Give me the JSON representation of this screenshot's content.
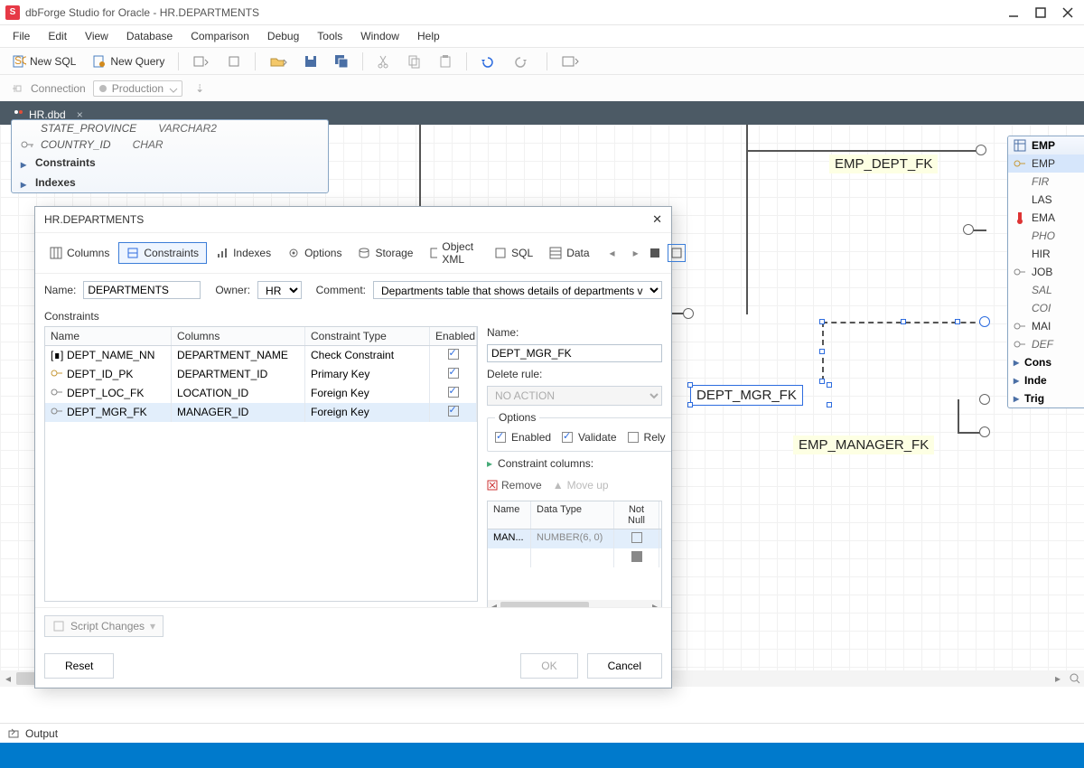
{
  "window": {
    "title": "dbForge Studio for Oracle - HR.DEPARTMENTS"
  },
  "menubar": [
    "File",
    "Edit",
    "View",
    "Database",
    "Comparison",
    "Debug",
    "Tools",
    "Window",
    "Help"
  ],
  "toolbar": {
    "newSql": "New SQL",
    "newQuery": "New Query"
  },
  "connection": {
    "label": "Connection",
    "value": "Production"
  },
  "docTab": {
    "label": "HR.dbd"
  },
  "diagram": {
    "table1": {
      "rows": [
        {
          "key": false,
          "name": "STATE_PROVINCE",
          "type": "VARCHAR2"
        },
        {
          "key": true,
          "name": "COUNTRY_ID",
          "type": "CHAR"
        }
      ],
      "sections": [
        "Constraints",
        "Indexes"
      ]
    },
    "empTable": {
      "header": "EMP",
      "rows": [
        {
          "name": "EMP",
          "key": true,
          "selected": true,
          "italic": false
        },
        {
          "name": "FIR",
          "italic": true
        },
        {
          "name": "LAS",
          "italic": false
        },
        {
          "name": "EMA",
          "italic": false,
          "therm": true
        },
        {
          "name": "PHO",
          "italic": true
        },
        {
          "name": "HIR",
          "italic": false
        },
        {
          "name": "JOB",
          "italic": false,
          "key": true
        },
        {
          "name": "SAL",
          "italic": true
        },
        {
          "name": "COI",
          "italic": true
        },
        {
          "name": "MAI",
          "italic": false,
          "key": true
        },
        {
          "name": "DEF",
          "italic": true,
          "key": true
        }
      ],
      "sections": [
        "Cons",
        "Inde",
        "Trig"
      ]
    },
    "fkLabels": {
      "empDept": "EMP_DEPT_FK",
      "deptMgr": "DEPT_MGR_FK",
      "empMgr": "EMP_MANAGER_FK"
    }
  },
  "dialog": {
    "title": "HR.DEPARTMENTS",
    "tabs": [
      "Columns",
      "Constraints",
      "Indexes",
      "Options",
      "Storage",
      "Object XML",
      "SQL",
      "Data"
    ],
    "activeTab": "Constraints",
    "form": {
      "nameLabel": "Name:",
      "name": "DEPARTMENTS",
      "ownerLabel": "Owner:",
      "owner": "HR",
      "commentLabel": "Comment:",
      "comment": "Departments table that shows details of departments v"
    },
    "sectionLabel": "Constraints",
    "grid": {
      "headers": {
        "name": "Name",
        "columns": "Columns",
        "type": "Constraint Type",
        "enabled": "Enabled"
      },
      "rows": [
        {
          "icon": "check",
          "name": "DEPT_NAME_NN",
          "columns": "DEPARTMENT_NAME",
          "type": "Check Constraint",
          "enabled": true
        },
        {
          "icon": "pk",
          "name": "DEPT_ID_PK",
          "columns": "DEPARTMENT_ID",
          "type": "Primary Key",
          "enabled": true
        },
        {
          "icon": "fk",
          "name": "DEPT_LOC_FK",
          "columns": "LOCATION_ID",
          "type": "Foreign Key",
          "enabled": true
        },
        {
          "icon": "fk",
          "name": "DEPT_MGR_FK",
          "columns": "MANAGER_ID",
          "type": "Foreign Key",
          "enabled": true,
          "selected": true
        }
      ]
    },
    "detail": {
      "nameLabel": "Name:",
      "name": "DEPT_MGR_FK",
      "deleteRuleLabel": "Delete rule:",
      "deleteRule": "NO ACTION",
      "optionsLegend": "Options",
      "enabled": "Enabled",
      "validate": "Validate",
      "rely": "Rely",
      "ccLabel": "Constraint columns:",
      "remove": "Remove",
      "moveUp": "Move up",
      "ccHeaders": {
        "name": "Name",
        "dt": "Data Type",
        "nn": "Not Null"
      },
      "ccRow": {
        "name": "MAN...",
        "dt": "NUMBER(6, 0)",
        "nn": false
      }
    },
    "scriptChanges": "Script Changes",
    "reset": "Reset",
    "ok": "OK",
    "cancel": "Cancel"
  },
  "output": {
    "label": "Output"
  }
}
